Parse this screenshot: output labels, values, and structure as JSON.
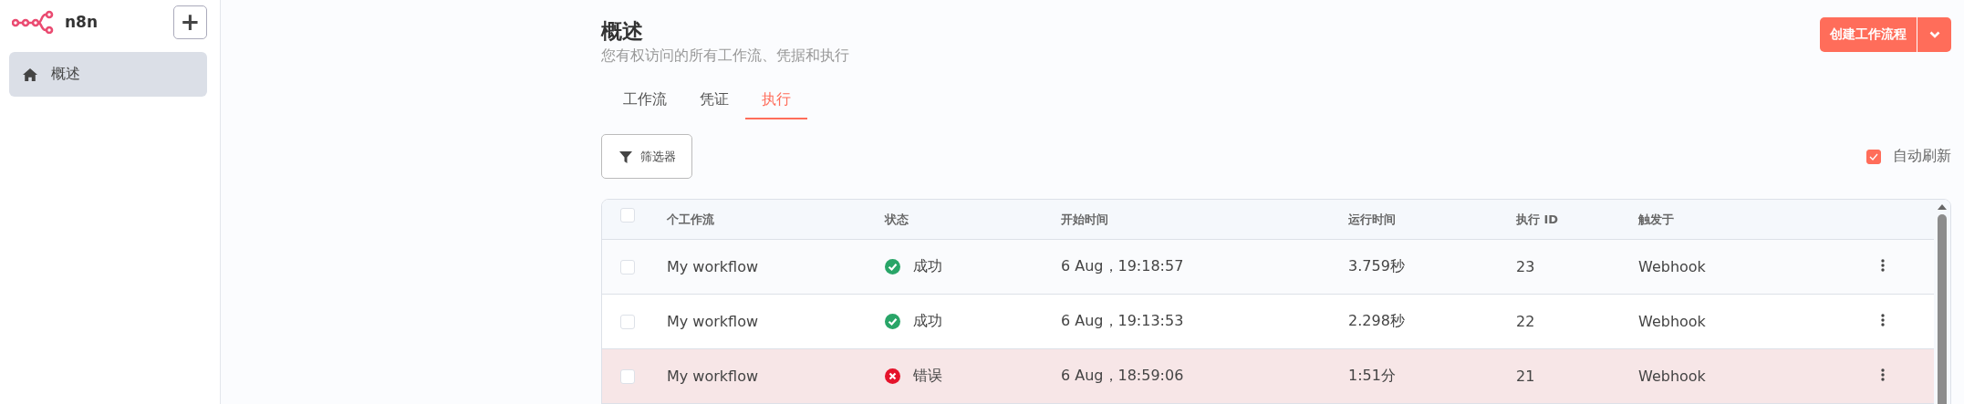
{
  "sidebar": {
    "brand": "n8n",
    "add_button": "+",
    "items": [
      {
        "label": "概述",
        "selected": true
      }
    ]
  },
  "header": {
    "title": "概述",
    "subtitle": "您有权访问的所有工作流、凭据和执行",
    "create_button": "创建工作流程"
  },
  "tabs": [
    {
      "label": "工作流",
      "selected": false
    },
    {
      "label": "凭证",
      "selected": false
    },
    {
      "label": "执行",
      "selected": true
    }
  ],
  "filter_button": "筛选器",
  "auto_refresh": {
    "label": "自动刷新",
    "checked": true
  },
  "table": {
    "select_all_checked": false,
    "columns": [
      "个工作流",
      "状态",
      "开始时间",
      "运行时间",
      "执行 ID",
      "触发于"
    ],
    "rows": [
      {
        "checked": false,
        "workflow": "My workflow",
        "status": "成功",
        "kind": "success",
        "started": "6 Aug，19:18:57",
        "runtime": "3.759秒",
        "id": "23",
        "trigger": "Webhook"
      },
      {
        "checked": false,
        "workflow": "My workflow",
        "status": "成功",
        "kind": "success",
        "started": "6 Aug，19:13:53",
        "runtime": "2.298秒",
        "id": "22",
        "trigger": "Webhook"
      },
      {
        "checked": false,
        "workflow": "My workflow",
        "status": "错误",
        "kind": "error",
        "started": "6 Aug，18:59:06",
        "runtime": "1:51分",
        "id": "21",
        "trigger": "Webhook"
      }
    ]
  }
}
